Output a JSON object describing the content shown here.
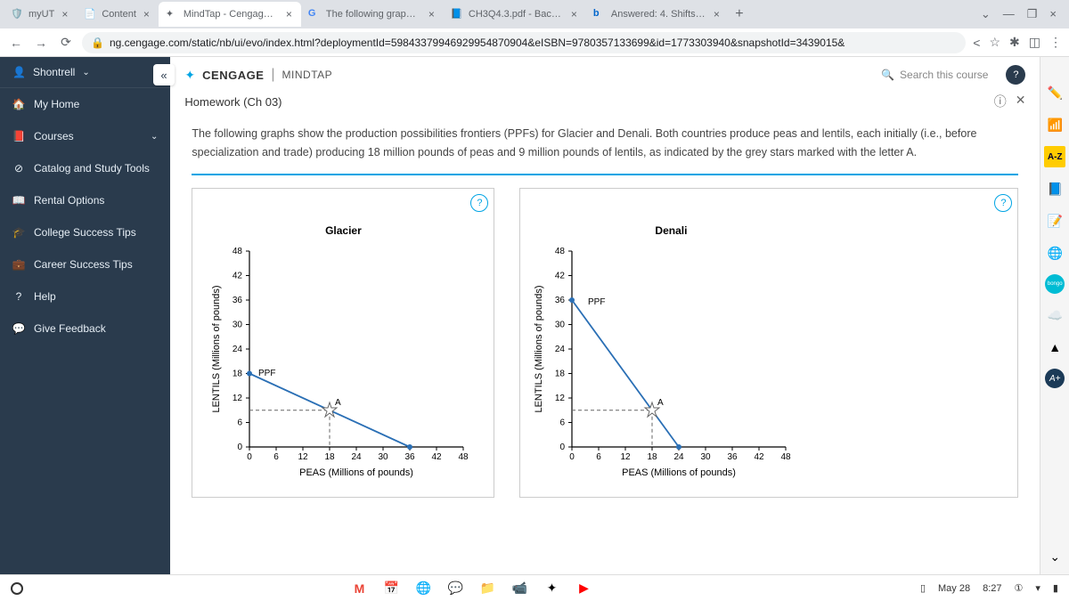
{
  "browser": {
    "tabs": [
      {
        "title": "myUT",
        "icon_color": "#e03a3a"
      },
      {
        "title": "Content",
        "icon_color": "#ff9800"
      },
      {
        "title": "MindTap - Cengage Lea",
        "icon_color": "#00a4e4",
        "active": true
      },
      {
        "title": "The following graphs s",
        "icon_color": "#4285f4"
      },
      {
        "title": "CH3Q4.3.pdf - Back to",
        "icon_color": "#1a73e8"
      },
      {
        "title": "Answered: 4. Shifts in p",
        "icon_color": "#0066cc"
      }
    ],
    "url": "ng.cengage.com/static/nb/ui/evo/index.html?deploymentId=59843379946929954870904&eISBN=9780357133699&id=1773303940&snapshotId=3439015&"
  },
  "user": {
    "name": "Shontrell"
  },
  "sidebar_items": [
    {
      "label": "My Home",
      "icon": "🏠"
    },
    {
      "label": "Courses",
      "icon": "📕",
      "chevron": true
    },
    {
      "label": "Catalog and Study Tools",
      "icon": "⊘"
    },
    {
      "label": "Rental Options",
      "icon": "📖"
    },
    {
      "label": "College Success Tips",
      "icon": "🎓"
    },
    {
      "label": "Career Success Tips",
      "icon": "💼"
    },
    {
      "label": "Help",
      "icon": "?"
    },
    {
      "label": "Give Feedback",
      "icon": "💬"
    }
  ],
  "brand": {
    "cengage": "CENGAGE",
    "mindtap": "MINDTAP"
  },
  "search_placeholder": "Search this course",
  "homework": {
    "title": "Homework (Ch 03)",
    "prompt": "The following graphs show the production possibilities frontiers (PPFs) for Glacier and Denali. Both countries produce peas and lentils, each initially (i.e., before specialization and trade) producing 18 million pounds of peas and 9 million pounds of lentils, as indicated by the grey stars marked with the letter A."
  },
  "chart_data": [
    {
      "type": "line",
      "title": "Glacier",
      "xlabel": "PEAS (Millions of pounds)",
      "ylabel": "LENTILS (Millions of pounds)",
      "xlim": [
        0,
        48
      ],
      "ylim": [
        0,
        48
      ],
      "x_ticks": [
        0,
        6,
        12,
        18,
        24,
        30,
        36,
        42,
        48
      ],
      "y_ticks": [
        0,
        6,
        12,
        18,
        24,
        30,
        36,
        42,
        48
      ],
      "series": [
        {
          "name": "PPF",
          "points": [
            [
              0,
              18
            ],
            [
              36,
              0
            ]
          ]
        }
      ],
      "point_A": {
        "x": 18,
        "y": 9,
        "label": "A"
      }
    },
    {
      "type": "line",
      "title": "Denali",
      "xlabel": "PEAS (Millions of pounds)",
      "ylabel": "LENTILS (Millions of pounds)",
      "xlim": [
        0,
        48
      ],
      "ylim": [
        0,
        48
      ],
      "x_ticks": [
        0,
        6,
        12,
        18,
        24,
        30,
        36,
        42,
        48
      ],
      "y_ticks": [
        0,
        6,
        12,
        18,
        24,
        30,
        36,
        42,
        48
      ],
      "series": [
        {
          "name": "PPF",
          "points": [
            [
              0,
              36
            ],
            [
              24,
              0
            ]
          ]
        }
      ],
      "point_A": {
        "x": 18,
        "y": 9,
        "label": "A"
      }
    }
  ],
  "taskbar": {
    "date": "May 28",
    "time": "8:27"
  }
}
